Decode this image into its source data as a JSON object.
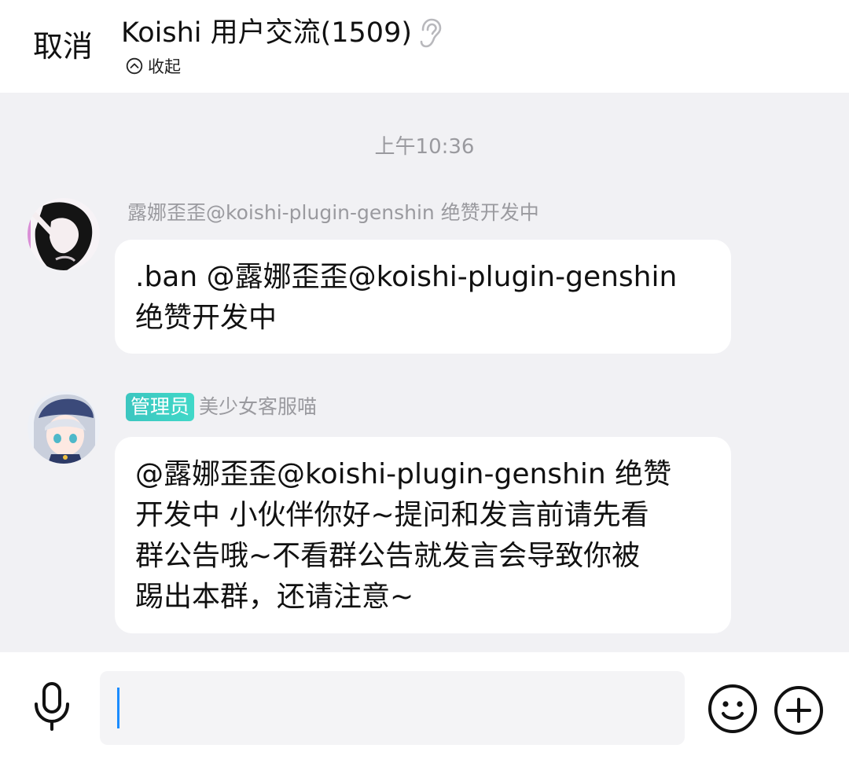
{
  "header": {
    "cancel_label": "取消",
    "title": "Koishi 用户交流(1509)",
    "collapse_label": "收起"
  },
  "chat": {
    "timestamp": "上午10:36",
    "messages": [
      {
        "sender": "露娜歪歪@koishi-plugin-genshin 绝赞开发中",
        "text_lines": [
          ".ban @露娜歪歪@koishi-plugin-genshin",
          "绝赞开发中"
        ]
      },
      {
        "badge": "管理员",
        "sender": "美少女客服喵",
        "text_lines": [
          "@露娜歪歪@koishi-plugin-genshin 绝赞",
          "开发中 小伙伴你好~提问和发言前请先看",
          "群公告哦~不看群公告就发言会导致你被",
          "踢出本群，还请注意~"
        ]
      }
    ]
  },
  "input": {
    "value": "",
    "placeholder": ""
  },
  "icons": {
    "ear": "ear-icon",
    "collapse": "chevron-up-circle-icon",
    "mic": "microphone-icon",
    "emoji": "smiley-icon",
    "plus": "plus-circle-icon"
  },
  "colors": {
    "admin_badge": "#3cc6c0",
    "caret": "#1a8cff",
    "chat_bg": "#f1f1f4"
  }
}
